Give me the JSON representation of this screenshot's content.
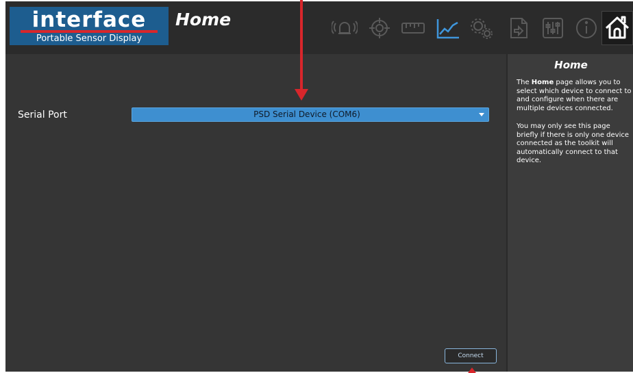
{
  "app": {
    "logo_word": "interface",
    "logo_subtitle": "Portable Sensor Display",
    "page_title": "Home"
  },
  "toolbar": {
    "icons": [
      "alarm-icon",
      "target-icon",
      "ruler-icon",
      "chart-icon",
      "gears-icon",
      "file-icon",
      "sliders-icon",
      "info-icon",
      "home-icon"
    ],
    "active_icon": "chart-icon"
  },
  "form": {
    "serial_port_label": "Serial Port",
    "serial_port_value": "PSD Serial Device (COM6)",
    "connect_label": "Connect"
  },
  "help": {
    "title": "Home",
    "p1_bold": "Home",
    "p1_pre": "The ",
    "p1_post": " page allows you to select which device to connect to and configure when there are multiple devices connected.",
    "p2": "You may only see this page briefly if there is only one device connected as the toolkit will automatically connect to that device."
  },
  "colors": {
    "accent": "#3e8fd0",
    "logo_bg": "#1d5d8f",
    "annotation": "#d8262b",
    "active_icon": "#3f96dc",
    "inactive_icon": "#5a5a5a"
  }
}
